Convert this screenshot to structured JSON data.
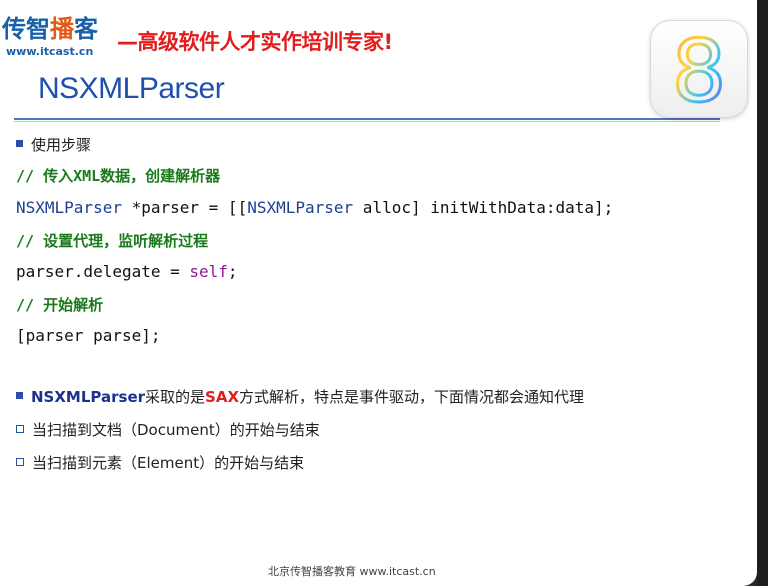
{
  "header": {
    "logo_part1": "传智",
    "logo_part2": "播",
    "logo_part3": "客",
    "logo_url": "www.itcast.cn",
    "slogan": "—高级软件人才实作培训专家!",
    "title": "NSXMLParser",
    "ios_icon_numeral": "8"
  },
  "body": {
    "step_heading": "使用步骤",
    "code": {
      "comment1": "// 传入XML数据，创建解析器",
      "line1_class1": "NSXMLParser",
      "line1_mid": " *parser = [[",
      "line1_class2": "NSXMLParser",
      "line1_end": " alloc] initWithData:data];",
      "comment2": "// 设置代理，监听解析过程",
      "line2_start": "parser.delegate = ",
      "line2_self": "self",
      "line2_end": ";",
      "comment3": "// 开始解析",
      "line3": "[parser parse];"
    },
    "point1_class": "NSXMLParser",
    "point1_mid": "采取的是",
    "point1_sax": "SAX",
    "point1_end": "方式解析，特点是事件驱动，下面情况都会通知代理",
    "sub1": "当扫描到文档（Document）的开始与结束",
    "sub2": "当扫描到元素（Element）的开始与结束"
  },
  "footer": {
    "text": "北京传智播客教育 www.itcast.cn"
  },
  "colors": {
    "title_blue": "#1f4fb0",
    "slogan_red": "#e11d1d",
    "comment_green": "#1c7a1c",
    "keyword_purple": "#8b1c8b"
  }
}
